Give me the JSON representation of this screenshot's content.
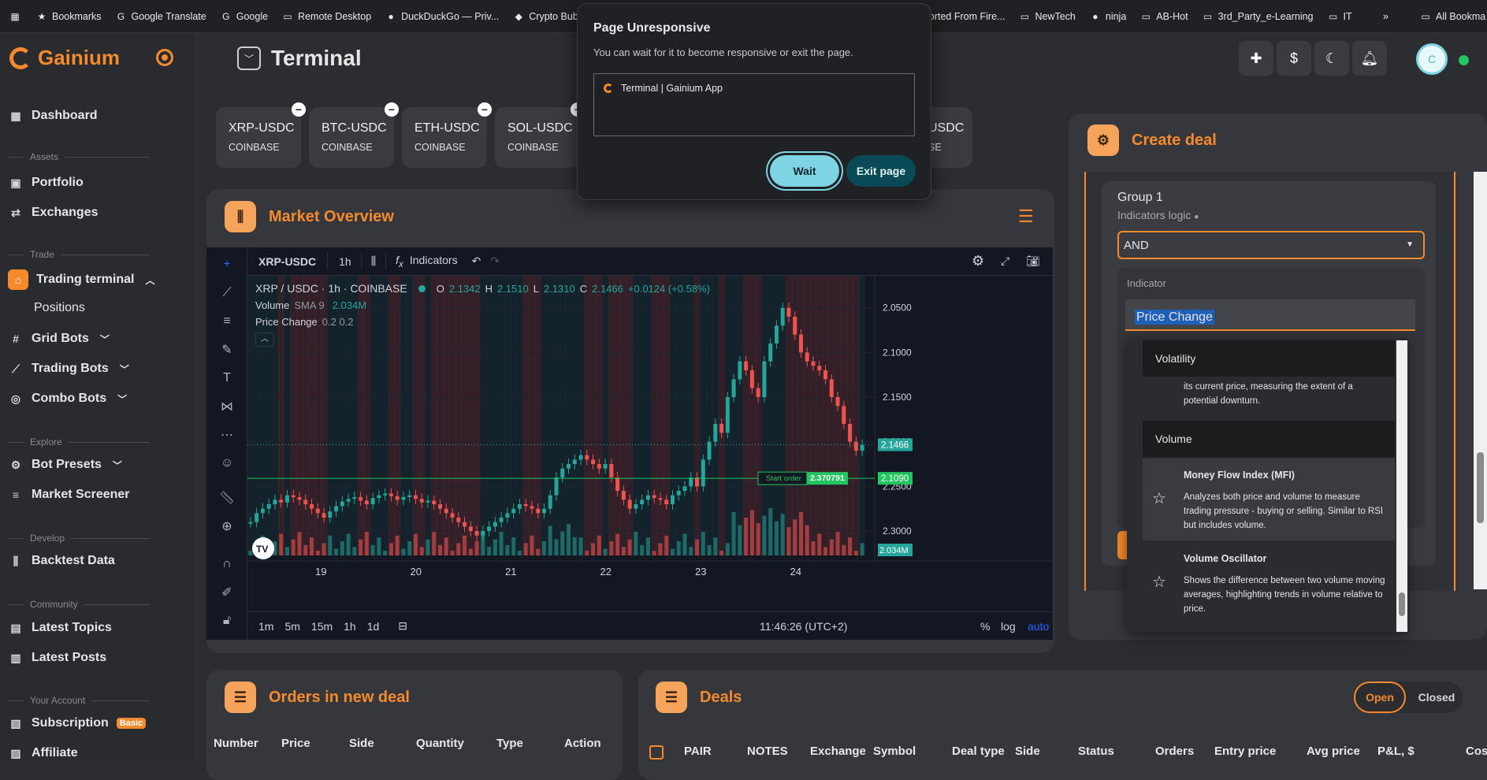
{
  "bookmarks": [
    {
      "icon": "star-icon",
      "label": "Bookmarks"
    },
    {
      "icon": "translate-icon",
      "label": "Google Translate"
    },
    {
      "icon": "google-icon",
      "label": "Google"
    },
    {
      "icon": "remote-desktop-icon",
      "label": "Remote Desktop"
    },
    {
      "icon": "duckduckgo-icon",
      "label": "DuckDuckGo — Priv..."
    },
    {
      "icon": "crypto-icon",
      "label": "Crypto Bubbl"
    },
    {
      "icon": "folder-icon",
      "label": "mported From Fire..."
    },
    {
      "icon": "folder-icon",
      "label": "NewTech"
    },
    {
      "icon": "ninja-icon",
      "label": "ninja"
    },
    {
      "icon": "folder-icon",
      "label": "AB-Hot"
    },
    {
      "icon": "folder-icon",
      "label": "3rd_Party_e-Learning"
    },
    {
      "icon": "folder-icon",
      "label": "IT"
    }
  ],
  "bookmarks_more": "»",
  "bookmarks_all": "All Bookma",
  "brand": "Gainium",
  "sidebar": {
    "dashboard": "Dashboard",
    "assets": "Assets",
    "portfolio": "Portfolio",
    "exchanges": "Exchanges",
    "trade": "Trade",
    "trading_terminal": "Trading terminal",
    "positions": "Positions",
    "grid_bots": "Grid Bots",
    "trading_bots": "Trading Bots",
    "combo_bots": "Combo Bots",
    "explore": "Explore",
    "bot_presets": "Bot Presets",
    "market_screener": "Market Screener",
    "develop": "Develop",
    "backtest_data": "Backtest Data",
    "community": "Community",
    "latest_topics": "Latest Topics",
    "latest_posts": "Latest Posts",
    "your_account": "Your Account",
    "subscription": "Subscription",
    "subscription_badge": "Basic",
    "affiliate": "Affiliate"
  },
  "header": {
    "title": "Terminal",
    "avatar": "C"
  },
  "pairs": [
    {
      "pair": "XRP-USDC",
      "exchange": "COINBASE"
    },
    {
      "pair": "BTC-USDC",
      "exchange": "COINBASE"
    },
    {
      "pair": "ETH-USDC",
      "exchange": "COINBASE"
    },
    {
      "pair": "SOL-USDC",
      "exchange": "COINBASE"
    },
    {
      "pair": "USDC",
      "exchange": "SE"
    }
  ],
  "market_overview": {
    "title": "Market Overview",
    "toolbar": {
      "symbol": "XRP-USDC",
      "interval": "1h",
      "indicators": "Indicators"
    },
    "legend": {
      "name": "XRP / USDC · 1h · COINBASE",
      "o_label": "O",
      "o": "2.1342",
      "h_label": "H",
      "h": "2.1510",
      "l_label": "L",
      "l": "2.1310",
      "c_label": "C",
      "c": "2.1466",
      "chg": "+0.0124 (+0.58%)",
      "volume_label": "Volume",
      "volume_sma": "SMA 9",
      "volume_val": "2.034M",
      "pc_label": "Price Change",
      "pc_val": "0.2 0.2"
    },
    "y_ticks": [
      "2.3000",
      "2.2500",
      "2.2000",
      "2.1500",
      "2.1000",
      "2.0500"
    ],
    "x_ticks": [
      "19",
      "20",
      "21",
      "22",
      "23",
      "24"
    ],
    "price_tag": "2.1466",
    "order_tag": "2.1090",
    "volume_tag": "2.034M",
    "start_order_label": "Start order",
    "start_order_value": "2.370791",
    "timeframes": [
      "1m",
      "5m",
      "15m",
      "1h",
      "1d"
    ],
    "clock": "11:46:26 (UTC+2)",
    "scale_pct": "%",
    "scale_log": "log",
    "scale_auto": "auto"
  },
  "chart_data": {
    "type": "candlestick",
    "title": "XRP / USDC · 1h · COINBASE",
    "x_ticks": [
      "19",
      "20",
      "21",
      "22",
      "23",
      "24"
    ],
    "ylim": [
      2.02,
      2.32
    ],
    "y_ticks": [
      2.05,
      2.1,
      2.15,
      2.2,
      2.25,
      2.3
    ],
    "close_series": [
      2.06,
      2.07,
      2.075,
      2.08,
      2.085,
      2.082,
      2.09,
      2.088,
      2.085,
      2.08,
      2.075,
      2.07,
      2.065,
      2.072,
      2.078,
      2.083,
      2.086,
      2.088,
      2.084,
      2.08,
      2.087,
      2.09,
      2.092,
      2.089,
      2.085,
      2.088,
      2.09,
      2.086,
      2.082,
      2.084,
      2.08,
      2.075,
      2.07,
      2.065,
      2.06,
      2.055,
      2.05,
      2.045,
      2.05,
      2.055,
      2.06,
      2.065,
      2.07,
      2.075,
      2.08,
      2.078,
      2.075,
      2.07,
      2.075,
      2.09,
      2.11,
      2.12,
      2.125,
      2.13,
      2.135,
      2.13,
      2.125,
      2.12,
      2.125,
      2.11,
      2.095,
      2.085,
      2.075,
      2.08,
      2.085,
      2.09,
      2.087,
      2.085,
      2.08,
      2.09,
      2.095,
      2.1,
      2.11,
      2.1,
      2.13,
      2.15,
      2.17,
      2.16,
      2.2,
      2.22,
      2.24,
      2.23,
      2.21,
      2.2,
      2.24,
      2.26,
      2.28,
      2.3,
      2.29,
      2.27,
      2.25,
      2.24,
      2.235,
      2.23,
      2.22,
      2.2,
      2.19,
      2.17,
      2.15,
      2.14,
      2.1466
    ],
    "volume_last": "2.034M",
    "last_price": 2.1466,
    "start_order": 2.109
  },
  "modal": {
    "title": "Page Unresponsive",
    "subtitle": "You can wait for it to become responsive or exit the page.",
    "page": "Terminal | Gainium App",
    "wait": "Wait",
    "exit": "Exit page"
  },
  "create_deal": {
    "title": "Create deal",
    "group": "Group 1",
    "logic_label": "Indicators logic",
    "logic_value": "AND",
    "indicator_label": "Indicator",
    "indicator_value": "Price Change",
    "dropdown": [
      {
        "type": "header",
        "label": "Volatility"
      },
      {
        "type": "desc",
        "text": "its current price, measuring the extent of a potential downturn."
      },
      {
        "type": "header",
        "label": "Volume"
      },
      {
        "type": "item",
        "title": "Money Flow Index (MFI)",
        "text": "Analyzes both price and volume to measure trading pressure - buying or selling. Similar to RSI but includes volume."
      },
      {
        "type": "item",
        "title": "Volume Oscillator",
        "text": "Shows the difference between two volume moving averages, highlighting trends in volume relative to price."
      }
    ]
  },
  "orders": {
    "title": "Orders in new deal",
    "columns": [
      "Number",
      "Price",
      "Side",
      "Quantity",
      "Type",
      "Action"
    ]
  },
  "deals": {
    "title": "Deals",
    "open": "Open",
    "closed": "Closed",
    "columns": [
      "PAIR",
      "NOTES",
      "Exchange",
      "Symbol",
      "Deal type",
      "Side",
      "Status",
      "Orders",
      "Entry price",
      "Avg price",
      "P&L, $",
      "Cost"
    ]
  },
  "colors": {
    "accent": "#f58a2c",
    "up": "#26a69a",
    "down": "#ef5350",
    "chart_bg": "#131722"
  }
}
